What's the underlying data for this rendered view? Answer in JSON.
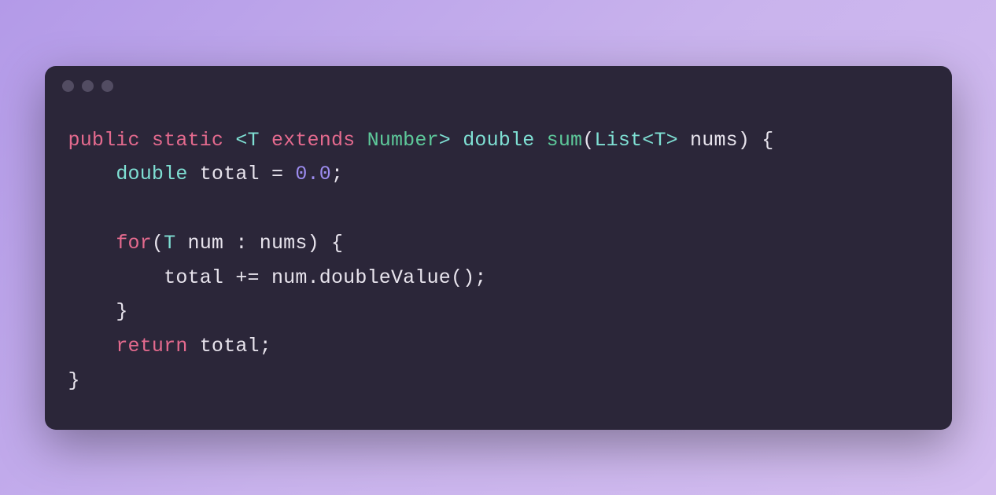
{
  "code": {
    "line1": {
      "kw_public": "public",
      "kw_static": "static",
      "angle_open": "<",
      "type_T": "T",
      "kw_extends": "extends",
      "type_Number": "Number",
      "angle_close": ">",
      "kw_double": "double",
      "fn_sum": "sum",
      "paren_open": "(",
      "type_List": "List",
      "generic_open": "<",
      "generic_T": "T",
      "generic_close": ">",
      "param_nums": " nums",
      "paren_close": ")",
      "brace_open": " {"
    },
    "line2": {
      "indent": "    ",
      "kw_double": "double",
      "var_total": " total ",
      "op_eq": "=",
      "sp": " ",
      "val_zero": "0.0",
      "semi": ";"
    },
    "line3": {
      "blank": ""
    },
    "line4": {
      "indent": "    ",
      "kw_for": "for",
      "paren_open": "(",
      "type_T": "T",
      "var_num": " num ",
      "op_colon": ":",
      "var_nums": " nums",
      "paren_close": ")",
      "brace_open": " {"
    },
    "line5": {
      "indent": "        ",
      "var_total": "total ",
      "op_pluseq": "+=",
      "var_num": " num",
      "dot": ".",
      "fn_doubleValue": "doubleValue",
      "parens": "()",
      "semi": ";"
    },
    "line6": {
      "indent": "    ",
      "brace_close": "}"
    },
    "line7": {
      "indent": "    ",
      "kw_return": "return",
      "var_total": " total",
      "semi": ";"
    },
    "line8": {
      "brace_close": "}"
    }
  }
}
